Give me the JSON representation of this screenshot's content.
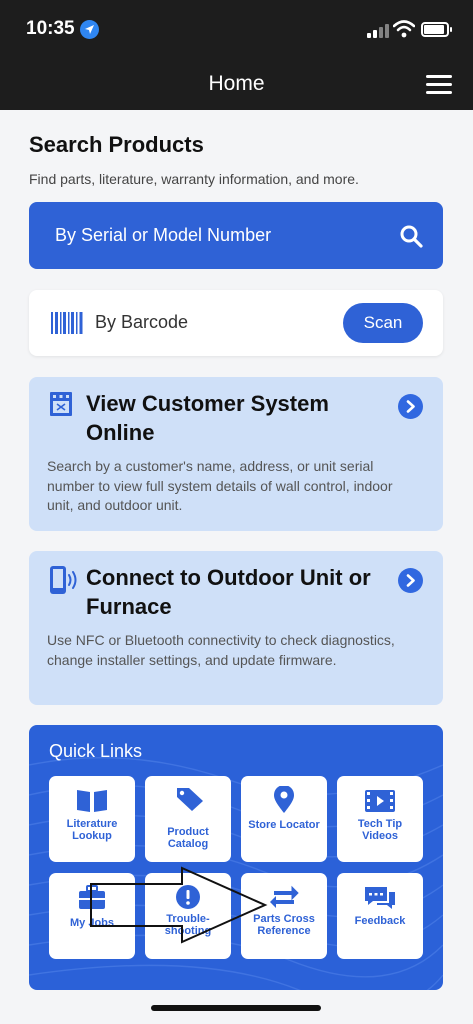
{
  "status_bar": {
    "time": "10:35"
  },
  "nav": {
    "title": "Home"
  },
  "search": {
    "title": "Search Products",
    "subtitle": "Find parts, literature, warranty information, and more.",
    "serial_label": "By Serial or Model Number",
    "barcode_label": "By Barcode",
    "scan_label": "Scan"
  },
  "cards": [
    {
      "title": "View Customer System Online",
      "description": "Search by a customer's name, address, or unit serial number to view full system details of wall control, indoor unit, and outdoor unit.",
      "icon": "building-icon"
    },
    {
      "title": "Connect to Outdoor Unit or Furnace",
      "description": "Use NFC or Bluetooth connectivity to check diagnostics, change installer settings, and update firmware.",
      "icon": "phone-signal-icon"
    }
  ],
  "quick_links": {
    "title": "Quick Links",
    "items": [
      {
        "label": "Literature Lookup",
        "icon": "book-icon"
      },
      {
        "label": "Product Catalog",
        "icon": "tag-icon"
      },
      {
        "label": "Store Locator",
        "icon": "map-pin-icon"
      },
      {
        "label": "Tech Tip Videos",
        "icon": "video-icon"
      },
      {
        "label": "My Jobs",
        "icon": "briefcase-icon"
      },
      {
        "label": "Trouble-shooting",
        "icon": "alert-icon"
      },
      {
        "label": "Parts Cross Reference",
        "icon": "swap-arrows-icon"
      },
      {
        "label": "Feedback",
        "icon": "chat-icon"
      }
    ]
  },
  "colors": {
    "brand_blue": "#2f62d6",
    "card_bg": "#cfe0f8",
    "nav_bg": "#1d1d1d"
  }
}
